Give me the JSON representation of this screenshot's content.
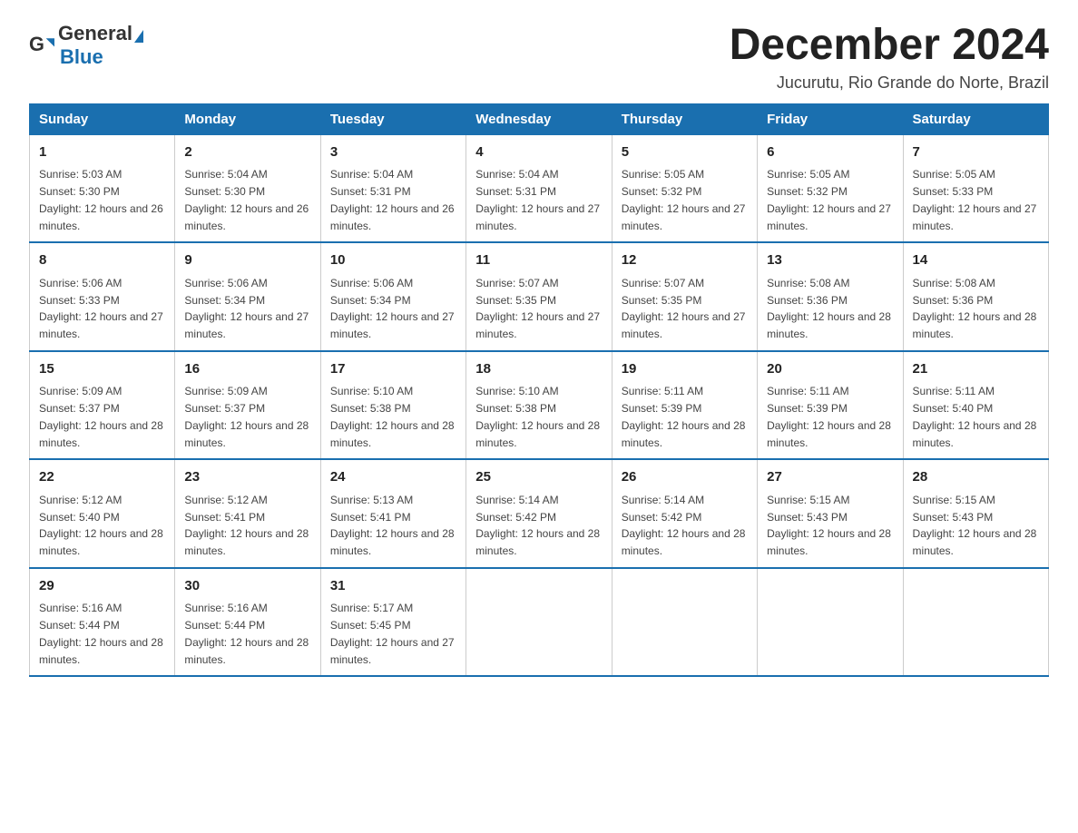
{
  "logo": {
    "text_general": "General",
    "text_blue": "Blue"
  },
  "title": "December 2024",
  "location": "Jucurutu, Rio Grande do Norte, Brazil",
  "days_of_week": [
    "Sunday",
    "Monday",
    "Tuesday",
    "Wednesday",
    "Thursday",
    "Friday",
    "Saturday"
  ],
  "weeks": [
    [
      {
        "day": "1",
        "sunrise": "5:03 AM",
        "sunset": "5:30 PM",
        "daylight": "12 hours and 26 minutes."
      },
      {
        "day": "2",
        "sunrise": "5:04 AM",
        "sunset": "5:30 PM",
        "daylight": "12 hours and 26 minutes."
      },
      {
        "day": "3",
        "sunrise": "5:04 AM",
        "sunset": "5:31 PM",
        "daylight": "12 hours and 26 minutes."
      },
      {
        "day": "4",
        "sunrise": "5:04 AM",
        "sunset": "5:31 PM",
        "daylight": "12 hours and 27 minutes."
      },
      {
        "day": "5",
        "sunrise": "5:05 AM",
        "sunset": "5:32 PM",
        "daylight": "12 hours and 27 minutes."
      },
      {
        "day": "6",
        "sunrise": "5:05 AM",
        "sunset": "5:32 PM",
        "daylight": "12 hours and 27 minutes."
      },
      {
        "day": "7",
        "sunrise": "5:05 AM",
        "sunset": "5:33 PM",
        "daylight": "12 hours and 27 minutes."
      }
    ],
    [
      {
        "day": "8",
        "sunrise": "5:06 AM",
        "sunset": "5:33 PM",
        "daylight": "12 hours and 27 minutes."
      },
      {
        "day": "9",
        "sunrise": "5:06 AM",
        "sunset": "5:34 PM",
        "daylight": "12 hours and 27 minutes."
      },
      {
        "day": "10",
        "sunrise": "5:06 AM",
        "sunset": "5:34 PM",
        "daylight": "12 hours and 27 minutes."
      },
      {
        "day": "11",
        "sunrise": "5:07 AM",
        "sunset": "5:35 PM",
        "daylight": "12 hours and 27 minutes."
      },
      {
        "day": "12",
        "sunrise": "5:07 AM",
        "sunset": "5:35 PM",
        "daylight": "12 hours and 27 minutes."
      },
      {
        "day": "13",
        "sunrise": "5:08 AM",
        "sunset": "5:36 PM",
        "daylight": "12 hours and 28 minutes."
      },
      {
        "day": "14",
        "sunrise": "5:08 AM",
        "sunset": "5:36 PM",
        "daylight": "12 hours and 28 minutes."
      }
    ],
    [
      {
        "day": "15",
        "sunrise": "5:09 AM",
        "sunset": "5:37 PM",
        "daylight": "12 hours and 28 minutes."
      },
      {
        "day": "16",
        "sunrise": "5:09 AM",
        "sunset": "5:37 PM",
        "daylight": "12 hours and 28 minutes."
      },
      {
        "day": "17",
        "sunrise": "5:10 AM",
        "sunset": "5:38 PM",
        "daylight": "12 hours and 28 minutes."
      },
      {
        "day": "18",
        "sunrise": "5:10 AM",
        "sunset": "5:38 PM",
        "daylight": "12 hours and 28 minutes."
      },
      {
        "day": "19",
        "sunrise": "5:11 AM",
        "sunset": "5:39 PM",
        "daylight": "12 hours and 28 minutes."
      },
      {
        "day": "20",
        "sunrise": "5:11 AM",
        "sunset": "5:39 PM",
        "daylight": "12 hours and 28 minutes."
      },
      {
        "day": "21",
        "sunrise": "5:11 AM",
        "sunset": "5:40 PM",
        "daylight": "12 hours and 28 minutes."
      }
    ],
    [
      {
        "day": "22",
        "sunrise": "5:12 AM",
        "sunset": "5:40 PM",
        "daylight": "12 hours and 28 minutes."
      },
      {
        "day": "23",
        "sunrise": "5:12 AM",
        "sunset": "5:41 PM",
        "daylight": "12 hours and 28 minutes."
      },
      {
        "day": "24",
        "sunrise": "5:13 AM",
        "sunset": "5:41 PM",
        "daylight": "12 hours and 28 minutes."
      },
      {
        "day": "25",
        "sunrise": "5:14 AM",
        "sunset": "5:42 PM",
        "daylight": "12 hours and 28 minutes."
      },
      {
        "day": "26",
        "sunrise": "5:14 AM",
        "sunset": "5:42 PM",
        "daylight": "12 hours and 28 minutes."
      },
      {
        "day": "27",
        "sunrise": "5:15 AM",
        "sunset": "5:43 PM",
        "daylight": "12 hours and 28 minutes."
      },
      {
        "day": "28",
        "sunrise": "5:15 AM",
        "sunset": "5:43 PM",
        "daylight": "12 hours and 28 minutes."
      }
    ],
    [
      {
        "day": "29",
        "sunrise": "5:16 AM",
        "sunset": "5:44 PM",
        "daylight": "12 hours and 28 minutes."
      },
      {
        "day": "30",
        "sunrise": "5:16 AM",
        "sunset": "5:44 PM",
        "daylight": "12 hours and 28 minutes."
      },
      {
        "day": "31",
        "sunrise": "5:17 AM",
        "sunset": "5:45 PM",
        "daylight": "12 hours and 27 minutes."
      },
      null,
      null,
      null,
      null
    ]
  ],
  "labels": {
    "sunrise": "Sunrise:",
    "sunset": "Sunset:",
    "daylight": "Daylight:"
  }
}
